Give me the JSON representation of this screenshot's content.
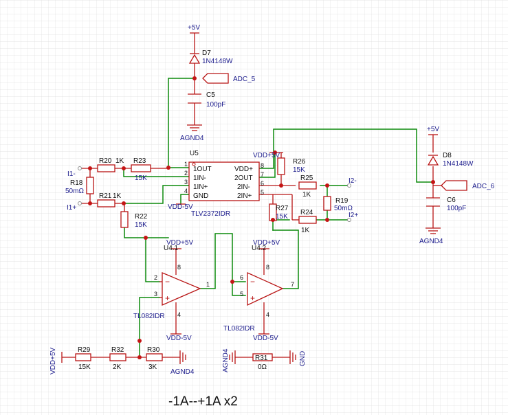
{
  "caption": "-1A--+1A x2",
  "rails": {
    "vcc": "+5V",
    "vdd_pos": "VDD+5V",
    "vdd_neg": "VDD-5V",
    "agnd": "AGND4",
    "gnd": "GND"
  },
  "nets": {
    "adc5": "ADC_5",
    "adc6": "ADC_6",
    "i1_neg": "I1-",
    "i1_pos": "I1+",
    "i2_neg": "I2-",
    "i2_pos": "I2+"
  },
  "parts": {
    "d7": {
      "ref": "D7",
      "value": "1N4148W"
    },
    "d8": {
      "ref": "D8",
      "value": "1N4148W"
    },
    "c5": {
      "ref": "C5",
      "value": "100pF"
    },
    "c6": {
      "ref": "C6",
      "value": "100pF"
    },
    "r18": {
      "ref": "R18",
      "value": "50mΩ"
    },
    "r19": {
      "ref": "R19",
      "value": "50mΩ"
    },
    "r20": {
      "ref": "R20",
      "value": "1K"
    },
    "r21": {
      "ref": "R21",
      "value": "1K"
    },
    "r22": {
      "ref": "R22",
      "value": "15K"
    },
    "r23": {
      "ref": "R23",
      "value": "15K"
    },
    "r24": {
      "ref": "R24",
      "value": "1K"
    },
    "r25": {
      "ref": "R25",
      "value": "1K"
    },
    "r26": {
      "ref": "R26",
      "value": "15K"
    },
    "r27": {
      "ref": "R27",
      "value": "15K"
    },
    "r29": {
      "ref": "R29",
      "value": "15K"
    },
    "r30": {
      "ref": "R30",
      "value": "3K"
    },
    "r31": {
      "ref": "R31",
      "value": "0Ω"
    },
    "r32": {
      "ref": "R32",
      "value": "2K"
    }
  },
  "u5": {
    "ref": "U5",
    "part": "TLV2372IDR",
    "pins": [
      {
        "num": "1",
        "name": "1OUT"
      },
      {
        "num": "2",
        "name": "1IN-"
      },
      {
        "num": "3",
        "name": "1IN+"
      },
      {
        "num": "4",
        "name": "GND"
      },
      {
        "num": "8",
        "name": "VDD+"
      },
      {
        "num": "7",
        "name": "2OUT"
      },
      {
        "num": "6",
        "name": "2IN-"
      },
      {
        "num": "5",
        "name": "2IN+"
      }
    ]
  },
  "u4_1": {
    "ref": "U4.1",
    "part": "TL082IDR",
    "pins": [
      "8",
      "2",
      "3",
      "1",
      "4"
    ]
  },
  "u4_2": {
    "ref": "U4.2",
    "part": "TL082IDR",
    "pins": [
      "8",
      "6",
      "5",
      "7",
      "4"
    ]
  },
  "colors": {
    "wire": "#0b8a0b",
    "component": "#b81414",
    "label": "#1b1b8c",
    "grid": "#dedede"
  }
}
